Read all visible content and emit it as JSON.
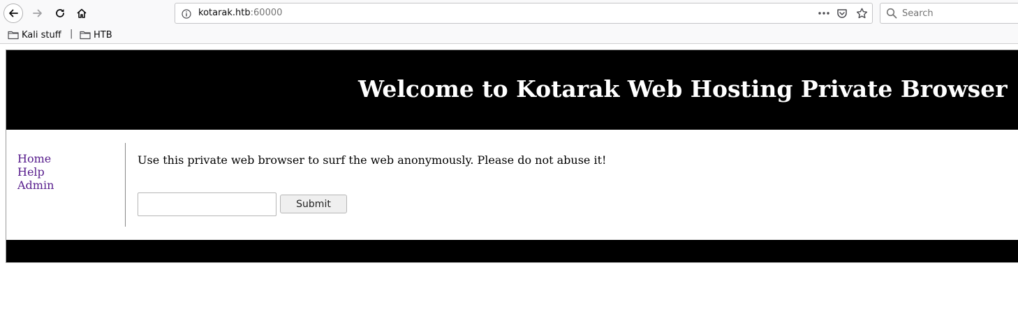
{
  "browser": {
    "url_host": "kotarak.htb",
    "url_port": ":60000",
    "search_placeholder": "Search",
    "bookmarks": [
      {
        "label": "Kali stuff"
      },
      {
        "label": "HTB"
      }
    ],
    "bookmark_separator": "|"
  },
  "page": {
    "header_title": "Welcome to Kotarak Web Hosting Private Browser",
    "nav": [
      {
        "label": "Home"
      },
      {
        "label": "Help"
      },
      {
        "label": "Admin"
      }
    ],
    "intro": "Use this private web browser to surf the web anonymously. Please do not abuse it!",
    "url_input_value": "",
    "submit_label": "Submit"
  },
  "colors": {
    "header_bg": "#000000",
    "header_text": "#ffffff",
    "visited_link": "#551a8b"
  }
}
